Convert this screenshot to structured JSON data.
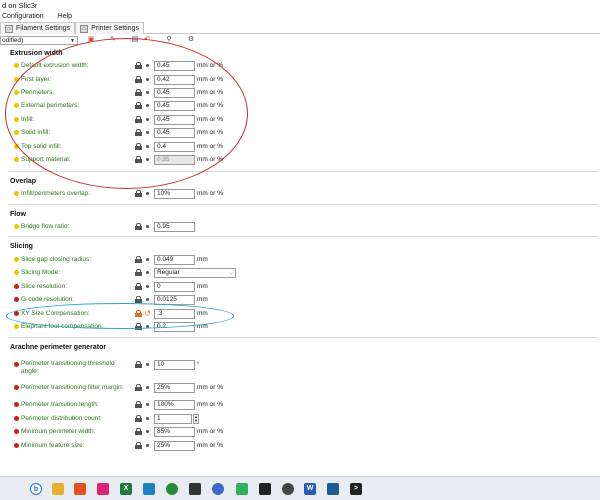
{
  "window": {
    "title": "d on Slic3r"
  },
  "menu": [
    "Configuration",
    "Help"
  ],
  "tabs": [
    {
      "label": "Filament Settings",
      "icon": "filament-icon"
    },
    {
      "label": "Printer Settings",
      "icon": "printer-icon"
    }
  ],
  "preset": {
    "value": "odified)"
  },
  "sections": {
    "extrusion_width": {
      "title": "Extrusion width",
      "rows": [
        {
          "label": "Default extrusion width:",
          "value": "0.45",
          "unit": "mm or %"
        },
        {
          "label": "First layer:",
          "value": "0.42",
          "unit": "mm or %"
        },
        {
          "label": "Perimeters:",
          "value": "0.45",
          "unit": "mm or %"
        },
        {
          "label": "External perimeters:",
          "value": "0.45",
          "unit": "mm or %"
        },
        {
          "label": "Infill:",
          "value": "0.45",
          "unit": "mm or %"
        },
        {
          "label": "Solid infill:",
          "value": "0.45",
          "unit": "mm or %"
        },
        {
          "label": "Top solid infill:",
          "value": "0.4",
          "unit": "mm or %"
        },
        {
          "label": "Support material:",
          "value": "0.35",
          "unit": "mm or %"
        }
      ]
    },
    "overlap": {
      "title": "Overlap",
      "rows": [
        {
          "label": "Infill/perimeters overlap:",
          "value": "10%",
          "unit": "mm or %"
        }
      ]
    },
    "flow": {
      "title": "Flow",
      "rows": [
        {
          "label": "Bridge flow ratio:",
          "value": "0.95",
          "unit": ""
        }
      ]
    },
    "slicing": {
      "title": "Slicing",
      "rows": [
        {
          "label": "Slice gap closing radius:",
          "value": "0.049",
          "unit": "mm"
        },
        {
          "label": "Slicing Mode:",
          "value": "Regular",
          "unit": ""
        },
        {
          "label": "Slice resolution:",
          "value": "0",
          "unit": "mm"
        },
        {
          "label": "G-code resolution:",
          "value": "0.0125",
          "unit": "mm"
        },
        {
          "label": "XY Size Compensation:",
          "value": ".3",
          "unit": "mm"
        },
        {
          "label": "Elephant foot compensation:",
          "value": "0.2",
          "unit": "mm"
        }
      ]
    },
    "arachne": {
      "title": "Arachne perimeter generator",
      "rows": [
        {
          "label": "Perimeter transitioning threshold angle:",
          "value": "10",
          "unit": "°"
        },
        {
          "label": "Perimeter transitioning filter margin:",
          "value": "25%",
          "unit": "mm or %"
        },
        {
          "label": "Perimeter transition length:",
          "value": "100%",
          "unit": "mm or %"
        },
        {
          "label": "Perimeter distribution count:",
          "value": "1",
          "unit": ""
        },
        {
          "label": "Minimum perimeter width:",
          "value": "85%",
          "unit": "mm or %"
        },
        {
          "label": "Minimum feature size:",
          "value": "25%",
          "unit": "mm or %"
        }
      ]
    }
  },
  "colors": {
    "label_green": "#2a7a1a",
    "dot_yellow": "#e8c800",
    "dot_red": "#d21a1a",
    "annotation_red": "#c83030",
    "annotation_cyan": "#2aa6c8",
    "lock_orange": "#e07020"
  }
}
